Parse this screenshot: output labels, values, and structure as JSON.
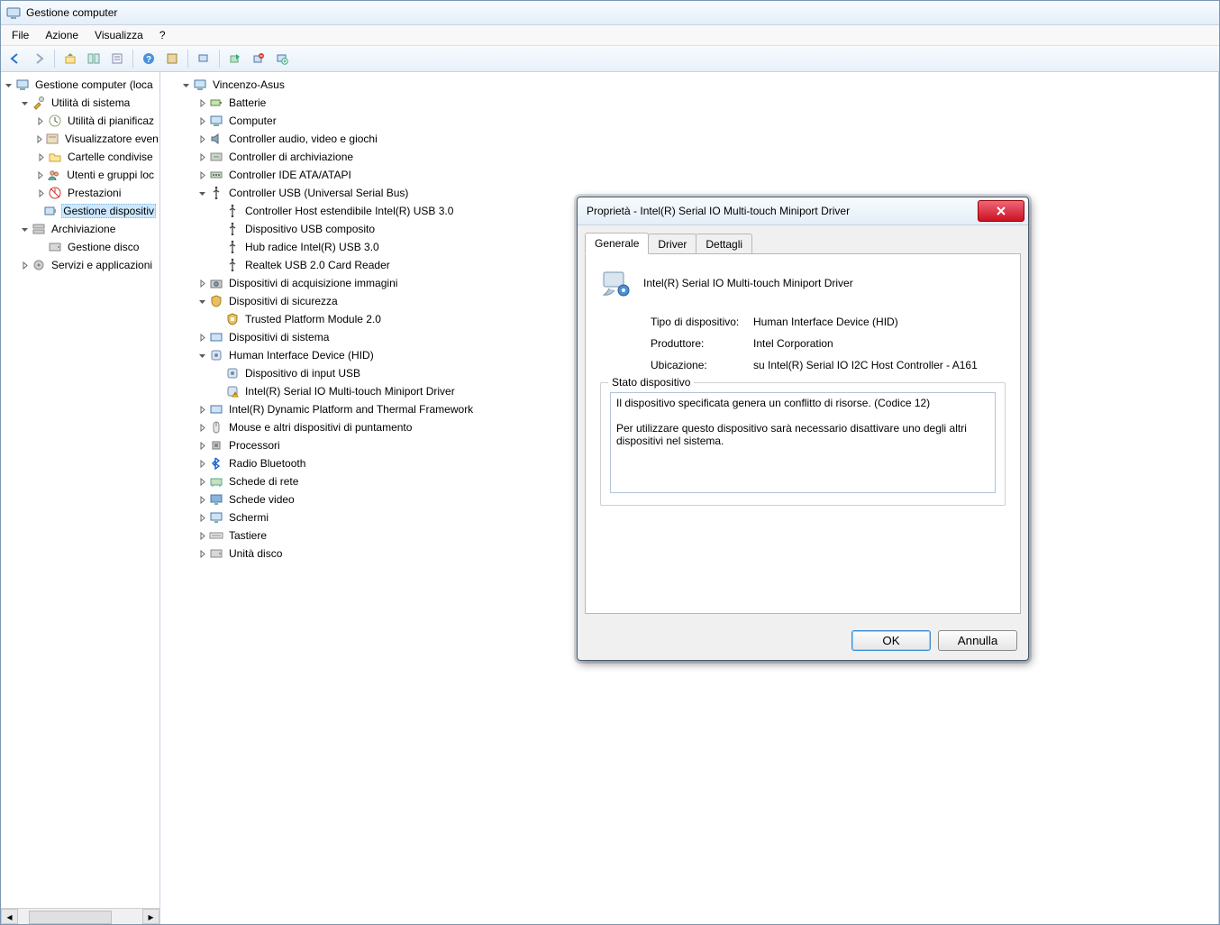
{
  "window": {
    "title": "Gestione computer"
  },
  "menu": {
    "file": "File",
    "azione": "Azione",
    "visualizza": "Visualizza",
    "help": "?"
  },
  "left_tree": [
    {
      "depth": 0,
      "exp": "open",
      "icon": "computer",
      "label": "Gestione computer (loca"
    },
    {
      "depth": 1,
      "exp": "open",
      "icon": "tools",
      "label": "Utilità di sistema"
    },
    {
      "depth": 2,
      "exp": "closed",
      "icon": "clock",
      "label": "Utilità di pianificaz"
    },
    {
      "depth": 2,
      "exp": "closed",
      "icon": "event",
      "label": "Visualizzatore even"
    },
    {
      "depth": 2,
      "exp": "closed",
      "icon": "folder-share",
      "label": "Cartelle condivise"
    },
    {
      "depth": 2,
      "exp": "closed",
      "icon": "users",
      "label": "Utenti e gruppi loc"
    },
    {
      "depth": 2,
      "exp": "closed",
      "icon": "perf",
      "label": "Prestazioni"
    },
    {
      "depth": 2,
      "exp": "none",
      "icon": "device",
      "label": "Gestione dispositiv",
      "selected": true
    },
    {
      "depth": 1,
      "exp": "open",
      "icon": "storage",
      "label": "Archiviazione"
    },
    {
      "depth": 2,
      "exp": "none",
      "icon": "disk",
      "label": "Gestione disco"
    },
    {
      "depth": 1,
      "exp": "closed",
      "icon": "services",
      "label": "Servizi e applicazioni"
    }
  ],
  "device_tree": [
    {
      "depth": 0,
      "exp": "open",
      "icon": "pc",
      "label": "Vincenzo-Asus"
    },
    {
      "depth": 1,
      "exp": "closed",
      "icon": "battery",
      "label": "Batterie"
    },
    {
      "depth": 1,
      "exp": "closed",
      "icon": "pc",
      "label": "Computer"
    },
    {
      "depth": 1,
      "exp": "closed",
      "icon": "audio",
      "label": "Controller audio, video e giochi"
    },
    {
      "depth": 1,
      "exp": "closed",
      "icon": "storage-ctl",
      "label": "Controller di archiviazione"
    },
    {
      "depth": 1,
      "exp": "closed",
      "icon": "ide",
      "label": "Controller IDE ATA/ATAPI"
    },
    {
      "depth": 1,
      "exp": "open",
      "icon": "usb",
      "label": "Controller USB (Universal Serial Bus)"
    },
    {
      "depth": 2,
      "exp": "none",
      "icon": "usb",
      "label": "Controller Host estendibile Intel(R) USB 3.0"
    },
    {
      "depth": 2,
      "exp": "none",
      "icon": "usb",
      "label": "Dispositivo USB composito"
    },
    {
      "depth": 2,
      "exp": "none",
      "icon": "usb",
      "label": "Hub radice Intel(R) USB 3.0"
    },
    {
      "depth": 2,
      "exp": "none",
      "icon": "usb",
      "label": "Realtek USB 2.0 Card Reader"
    },
    {
      "depth": 1,
      "exp": "closed",
      "icon": "imaging",
      "label": "Dispositivi di acquisizione immagini"
    },
    {
      "depth": 1,
      "exp": "open",
      "icon": "security",
      "label": "Dispositivi di sicurezza"
    },
    {
      "depth": 2,
      "exp": "none",
      "icon": "tpm",
      "label": "Trusted Platform Module 2.0"
    },
    {
      "depth": 1,
      "exp": "closed",
      "icon": "system",
      "label": "Dispositivi di sistema"
    },
    {
      "depth": 1,
      "exp": "open",
      "icon": "hid",
      "label": "Human Interface Device (HID)"
    },
    {
      "depth": 2,
      "exp": "none",
      "icon": "hid",
      "label": "Dispositivo di input USB"
    },
    {
      "depth": 2,
      "exp": "none",
      "icon": "hid-warn",
      "label": "Intel(R) Serial IO Multi-touch Miniport Driver"
    },
    {
      "depth": 1,
      "exp": "closed",
      "icon": "system",
      "label": "Intel(R) Dynamic Platform and Thermal Framework"
    },
    {
      "depth": 1,
      "exp": "closed",
      "icon": "mouse",
      "label": "Mouse e altri dispositivi di puntamento"
    },
    {
      "depth": 1,
      "exp": "closed",
      "icon": "cpu",
      "label": "Processori"
    },
    {
      "depth": 1,
      "exp": "closed",
      "icon": "bluetooth",
      "label": "Radio Bluetooth"
    },
    {
      "depth": 1,
      "exp": "closed",
      "icon": "network",
      "label": "Schede di rete"
    },
    {
      "depth": 1,
      "exp": "closed",
      "icon": "display",
      "label": "Schede video"
    },
    {
      "depth": 1,
      "exp": "closed",
      "icon": "monitor",
      "label": "Schermi"
    },
    {
      "depth": 1,
      "exp": "closed",
      "icon": "keyboard",
      "label": "Tastiere"
    },
    {
      "depth": 1,
      "exp": "closed",
      "icon": "disk",
      "label": "Unità disco"
    }
  ],
  "dialog": {
    "title": "Proprietà - Intel(R) Serial IO Multi-touch Miniport Driver",
    "tabs": {
      "generale": "Generale",
      "driver": "Driver",
      "dettagli": "Dettagli"
    },
    "device_name": "Intel(R) Serial IO Multi-touch Miniport Driver",
    "labels": {
      "tipo": "Tipo di dispositivo:",
      "produttore": "Produttore:",
      "ubicazione": "Ubicazione:",
      "stato": "Stato dispositivo"
    },
    "values": {
      "tipo": "Human Interface Device (HID)",
      "produttore": "Intel Corporation",
      "ubicazione": "su Intel(R) Serial IO I2C Host Controller - A161"
    },
    "status_text": "Il dispositivo specificata genera un conflitto di risorse. (Codice 12)\n\nPer utilizzare questo dispositivo sarà necessario disattivare uno degli altri dispositivi nel sistema.",
    "buttons": {
      "ok": "OK",
      "cancel": "Annulla"
    }
  }
}
